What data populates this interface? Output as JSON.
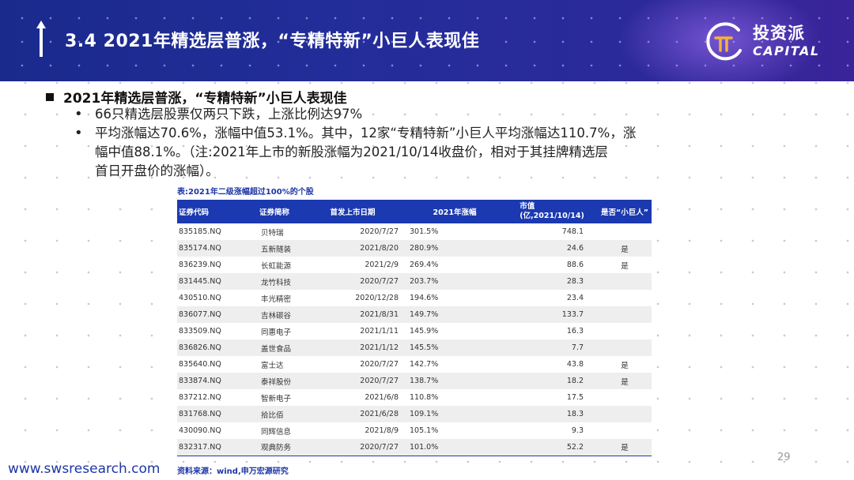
{
  "header": {
    "title": "3.4 2021年精选层普涨，“专精特新”小巨人表现佳",
    "logo_cn": "投资派",
    "logo_en": "CAPITAL"
  },
  "content": {
    "heading": "2021年精选层普涨，“专精特新”小巨人表现佳",
    "bullets": [
      "66只精选层股票仅两只下跌，上涨比例达97%",
      "平均涨幅达70.6%，涨幅中值53.1%。其中，12家“专精特新”小巨人平均涨幅达110.7%，涨",
      "幅中值88.1%。（注:2021年上市的新股涨幅为2021/10/14收盘价，相对于其挂牌精选层",
      "首日开盘价的涨幅）。"
    ]
  },
  "table": {
    "title": "表:2021年二级涨幅超过100%的个股",
    "columns": [
      "证券代码",
      "证券简称",
      "首发上市日期",
      "2021年涨幅",
      "市值",
      "(亿,2021/10/14)",
      "是否“小巨人”"
    ],
    "rows": [
      [
        "835185.NQ",
        "贝特瑞",
        "2020/7/27",
        "301.5%",
        "748.1",
        ""
      ],
      [
        "835174.NQ",
        "五新隧装",
        "2021/8/20",
        "280.9%",
        "24.6",
        "是"
      ],
      [
        "836239.NQ",
        "长虹能源",
        "2021/2/9",
        "269.4%",
        "88.6",
        "是"
      ],
      [
        "831445.NQ",
        "龙竹科技",
        "2020/7/27",
        "203.7%",
        "28.3",
        ""
      ],
      [
        "430510.NQ",
        "丰光精密",
        "2020/12/28",
        "194.6%",
        "23.4",
        ""
      ],
      [
        "836077.NQ",
        "吉林碳谷",
        "2021/8/31",
        "149.7%",
        "133.7",
        ""
      ],
      [
        "833509.NQ",
        "同惠电子",
        "2021/1/11",
        "145.9%",
        "16.3",
        ""
      ],
      [
        "836826.NQ",
        "盖世食品",
        "2021/1/12",
        "145.5%",
        "7.7",
        ""
      ],
      [
        "835640.NQ",
        "富士达",
        "2020/7/27",
        "142.7%",
        "43.8",
        "是"
      ],
      [
        "833874.NQ",
        "泰祥股份",
        "2020/7/27",
        "138.7%",
        "18.2",
        "是"
      ],
      [
        "837212.NQ",
        "智新电子",
        "2021/6/8",
        "110.8%",
        "17.5",
        ""
      ],
      [
        "831768.NQ",
        "拾比佰",
        "2021/6/28",
        "109.1%",
        "18.3",
        ""
      ],
      [
        "430090.NQ",
        "同辉信息",
        "2021/8/9",
        "105.1%",
        "9.3",
        ""
      ],
      [
        "832317.NQ",
        "观典防务",
        "2020/7/27",
        "101.0%",
        "52.2",
        "是"
      ]
    ],
    "source": "资料来源：wind,申万宏源研究"
  },
  "footer": {
    "website": "www.swsresearch.com",
    "page_number": "29"
  },
  "colors": {
    "banner": "#1a2a8c",
    "table_header": "#1b39b0",
    "accent_text": "#1d35a6"
  }
}
